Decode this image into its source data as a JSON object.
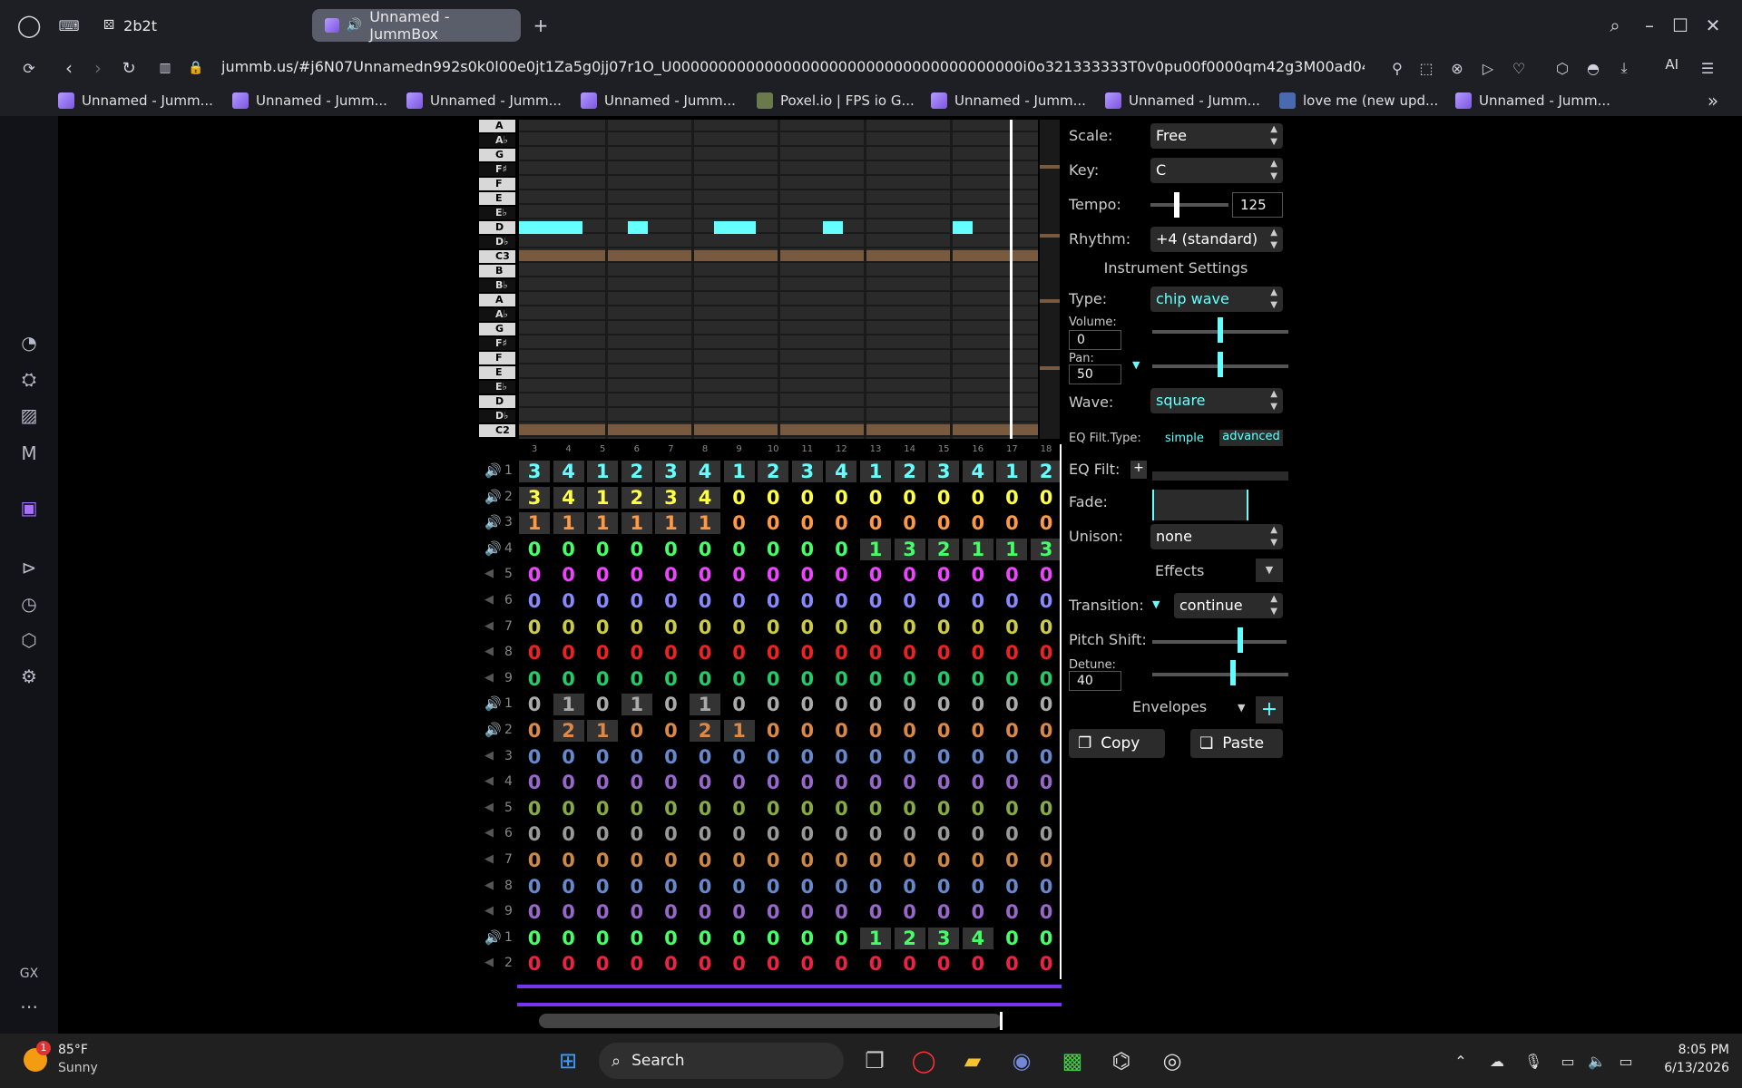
{
  "browser": {
    "tabs": [
      {
        "label": "2b2t"
      },
      {
        "label": "Unnamed - JummBox"
      }
    ],
    "new_tab": "+",
    "url": "jummb.us/#j6N07Unnamedn992s0k0l00e0jt1Za5g0jj07r1O_U00000000000000000000000000000000000000i0o321333333T0v0pu00f0000qm42g3M00ad04",
    "ai_label": "AI",
    "bookmarks": [
      "Unnamed - Jumm...",
      "Unnamed - Jumm...",
      "Unnamed - Jumm...",
      "Unnamed - Jumm...",
      "Poxel.io | FPS io G...",
      "Unnamed - Jumm...",
      "Unnamed - Jumm...",
      "love me (new upd...",
      "Unnamed - Jumm..."
    ]
  },
  "sidebar_gx": "GX",
  "piano_keys": [
    {
      "label": "A",
      "type": "w"
    },
    {
      "label": "A♭",
      "type": "b"
    },
    {
      "label": "G",
      "type": "w"
    },
    {
      "label": "F♯",
      "type": "b"
    },
    {
      "label": "F",
      "type": "w"
    },
    {
      "label": "E",
      "type": "w"
    },
    {
      "label": "E♭",
      "type": "b"
    },
    {
      "label": "D",
      "type": "w"
    },
    {
      "label": "D♭",
      "type": "b"
    },
    {
      "label": "C3",
      "type": "w"
    },
    {
      "label": "B",
      "type": "w"
    },
    {
      "label": "B♭",
      "type": "b"
    },
    {
      "label": "A",
      "type": "w"
    },
    {
      "label": "A♭",
      "type": "b"
    },
    {
      "label": "G",
      "type": "w"
    },
    {
      "label": "F♯",
      "type": "b"
    },
    {
      "label": "F",
      "type": "w"
    },
    {
      "label": "E",
      "type": "w"
    },
    {
      "label": "E♭",
      "type": "b"
    },
    {
      "label": "D",
      "type": "w"
    },
    {
      "label": "D♭",
      "type": "b"
    },
    {
      "label": "C2",
      "type": "w"
    }
  ],
  "bar_numbers": [
    "3",
    "4",
    "5",
    "6",
    "7",
    "8",
    "9",
    "10",
    "11",
    "12",
    "13",
    "14",
    "15",
    "16",
    "17",
    "18"
  ],
  "channels": [
    {
      "num": "1",
      "color": "#66ffff",
      "icon": "on",
      "values": [
        "3",
        "4",
        "1",
        "2",
        "3",
        "4",
        "1",
        "2",
        "3",
        "4",
        "1",
        "2",
        "3",
        "4",
        "1",
        "2"
      ]
    },
    {
      "num": "2",
      "color": "#ffff44",
      "icon": "on",
      "values": [
        "3",
        "4",
        "1",
        "2",
        "3",
        "4",
        "0",
        "0",
        "0",
        "0",
        "0",
        "0",
        "0",
        "0",
        "0",
        "0"
      ]
    },
    {
      "num": "3",
      "color": "#ff9944",
      "icon": "on",
      "values": [
        "1",
        "1",
        "1",
        "1",
        "1",
        "1",
        "0",
        "0",
        "0",
        "0",
        "0",
        "0",
        "0",
        "0",
        "0",
        "0"
      ]
    },
    {
      "num": "4",
      "color": "#44ff66",
      "icon": "on",
      "values": [
        "0",
        "0",
        "0",
        "0",
        "0",
        "0",
        "0",
        "0",
        "0",
        "0",
        "1",
        "3",
        "2",
        "1",
        "1",
        "3"
      ]
    },
    {
      "num": "5",
      "color": "#ee44ff",
      "icon": "off",
      "values": [
        "0",
        "0",
        "0",
        "0",
        "0",
        "0",
        "0",
        "0",
        "0",
        "0",
        "0",
        "0",
        "0",
        "0",
        "0",
        "0"
      ]
    },
    {
      "num": "6",
      "color": "#8888ff",
      "icon": "off",
      "values": [
        "0",
        "0",
        "0",
        "0",
        "0",
        "0",
        "0",
        "0",
        "0",
        "0",
        "0",
        "0",
        "0",
        "0",
        "0",
        "0"
      ]
    },
    {
      "num": "7",
      "color": "#cccc44",
      "icon": "off",
      "values": [
        "0",
        "0",
        "0",
        "0",
        "0",
        "0",
        "0",
        "0",
        "0",
        "0",
        "0",
        "0",
        "0",
        "0",
        "0",
        "0"
      ]
    },
    {
      "num": "8",
      "color": "#ee2222",
      "icon": "off",
      "values": [
        "0",
        "0",
        "0",
        "0",
        "0",
        "0",
        "0",
        "0",
        "0",
        "0",
        "0",
        "0",
        "0",
        "0",
        "0",
        "0"
      ]
    },
    {
      "num": "9",
      "color": "#22cc66",
      "icon": "off",
      "values": [
        "0",
        "0",
        "0",
        "0",
        "0",
        "0",
        "0",
        "0",
        "0",
        "0",
        "0",
        "0",
        "0",
        "0",
        "0",
        "0"
      ]
    },
    {
      "num": "1",
      "color": "#aaaaaa",
      "icon": "on",
      "values": [
        "0",
        "1",
        "0",
        "1",
        "0",
        "1",
        "0",
        "0",
        "0",
        "0",
        "0",
        "0",
        "0",
        "0",
        "0",
        "0"
      ]
    },
    {
      "num": "2",
      "color": "#dd8844",
      "icon": "on",
      "values": [
        "0",
        "2",
        "1",
        "0",
        "0",
        "2",
        "1",
        "0",
        "0",
        "0",
        "0",
        "0",
        "0",
        "0",
        "0",
        "0"
      ]
    },
    {
      "num": "3",
      "color": "#6688cc",
      "icon": "off",
      "values": [
        "0",
        "0",
        "0",
        "0",
        "0",
        "0",
        "0",
        "0",
        "0",
        "0",
        "0",
        "0",
        "0",
        "0",
        "0",
        "0"
      ]
    },
    {
      "num": "4",
      "color": "#9966cc",
      "icon": "off",
      "values": [
        "0",
        "0",
        "0",
        "0",
        "0",
        "0",
        "0",
        "0",
        "0",
        "0",
        "0",
        "0",
        "0",
        "0",
        "0",
        "0"
      ]
    },
    {
      "num": "5",
      "color": "#88aa44",
      "icon": "off",
      "values": [
        "0",
        "0",
        "0",
        "0",
        "0",
        "0",
        "0",
        "0",
        "0",
        "0",
        "0",
        "0",
        "0",
        "0",
        "0",
        "0"
      ]
    },
    {
      "num": "6",
      "color": "#999999",
      "icon": "off",
      "values": [
        "0",
        "0",
        "0",
        "0",
        "0",
        "0",
        "0",
        "0",
        "0",
        "0",
        "0",
        "0",
        "0",
        "0",
        "0",
        "0"
      ]
    },
    {
      "num": "7",
      "color": "#cc8844",
      "icon": "off",
      "values": [
        "0",
        "0",
        "0",
        "0",
        "0",
        "0",
        "0",
        "0",
        "0",
        "0",
        "0",
        "0",
        "0",
        "0",
        "0",
        "0"
      ]
    },
    {
      "num": "8",
      "color": "#6688cc",
      "icon": "off",
      "values": [
        "0",
        "0",
        "0",
        "0",
        "0",
        "0",
        "0",
        "0",
        "0",
        "0",
        "0",
        "0",
        "0",
        "0",
        "0",
        "0"
      ]
    },
    {
      "num": "9",
      "color": "#9966cc",
      "icon": "off",
      "values": [
        "0",
        "0",
        "0",
        "0",
        "0",
        "0",
        "0",
        "0",
        "0",
        "0",
        "0",
        "0",
        "0",
        "0",
        "0",
        "0"
      ]
    },
    {
      "num": "1",
      "color": "#44ff66",
      "icon": "mod",
      "values": [
        "0",
        "0",
        "0",
        "0",
        "0",
        "0",
        "0",
        "0",
        "0",
        "0",
        "1",
        "2",
        "3",
        "4",
        "0",
        "0"
      ]
    },
    {
      "num": "2",
      "color": "#ee2244",
      "icon": "off",
      "values": [
        "0",
        "0",
        "0",
        "0",
        "0",
        "0",
        "0",
        "0",
        "0",
        "0",
        "0",
        "0",
        "0",
        "0",
        "0",
        "0"
      ]
    }
  ],
  "settings": {
    "scale_label": "Scale:",
    "scale": "Free",
    "key_label": "Key:",
    "key": "C",
    "tempo_label": "Tempo:",
    "tempo": "125",
    "rhythm_label": "Rhythm:",
    "rhythm": "+4 (standard)",
    "instrument_heading": "Instrument Settings",
    "type_label": "Type:",
    "type": "chip wave",
    "volume_label": "Volume:",
    "volume": "0",
    "pan_label": "Pan:",
    "pan": "50",
    "wave_label": "Wave:",
    "wave": "square",
    "eqtype_label": "EQ Filt.Type:",
    "eq_simple": "simple",
    "eq_advanced": "advanced",
    "eqfilt_label": "EQ Filt:",
    "eq_plus": "+",
    "fade_label": "Fade:",
    "unison_label": "Unison:",
    "unison": "none",
    "effects_label": "Effects",
    "transition_label": "Transition:",
    "transition": "continue",
    "pitchshift_label": "Pitch Shift:",
    "detune_label": "Detune:",
    "detune": "40",
    "envelopes_label": "Envelopes",
    "env_plus": "+",
    "copy": "Copy",
    "paste": "Paste"
  },
  "taskbar": {
    "temp": "85°F",
    "weather": "Sunny",
    "weather_badge": "1",
    "search": "Search",
    "time": "8:05 PM",
    "date": "6/13/2026"
  }
}
